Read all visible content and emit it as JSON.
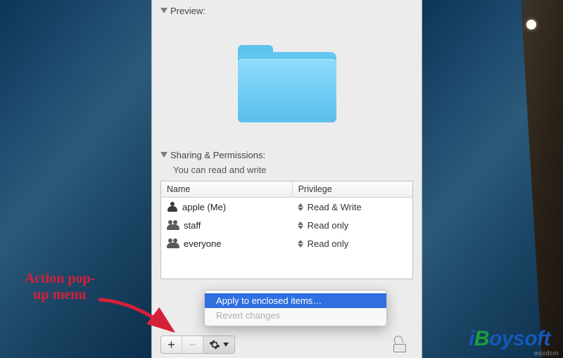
{
  "preview": {
    "title": "Preview:"
  },
  "sharing": {
    "title": "Sharing & Permissions:",
    "subtitle": "You can read and write",
    "columns": {
      "name": "Name",
      "privilege": "Privilege"
    },
    "rows": [
      {
        "icon": "person-icon",
        "name": "apple (Me)",
        "privilege": "Read & Write"
      },
      {
        "icon": "group-icon",
        "name": "staff",
        "privilege": "Read only"
      },
      {
        "icon": "group-icon",
        "name": "everyone",
        "privilege": "Read only"
      }
    ]
  },
  "action_menu": {
    "items": [
      {
        "label": "Apply to enclosed items…",
        "selected": true,
        "enabled": true
      },
      {
        "label": "Revert changes",
        "selected": false,
        "enabled": false
      }
    ]
  },
  "annotation": {
    "text": "Action pop-up menu"
  },
  "branding": {
    "logo_i": "i",
    "logo_b": "B",
    "logo_rest": "oysoft",
    "watermark": "wsxdcm"
  }
}
